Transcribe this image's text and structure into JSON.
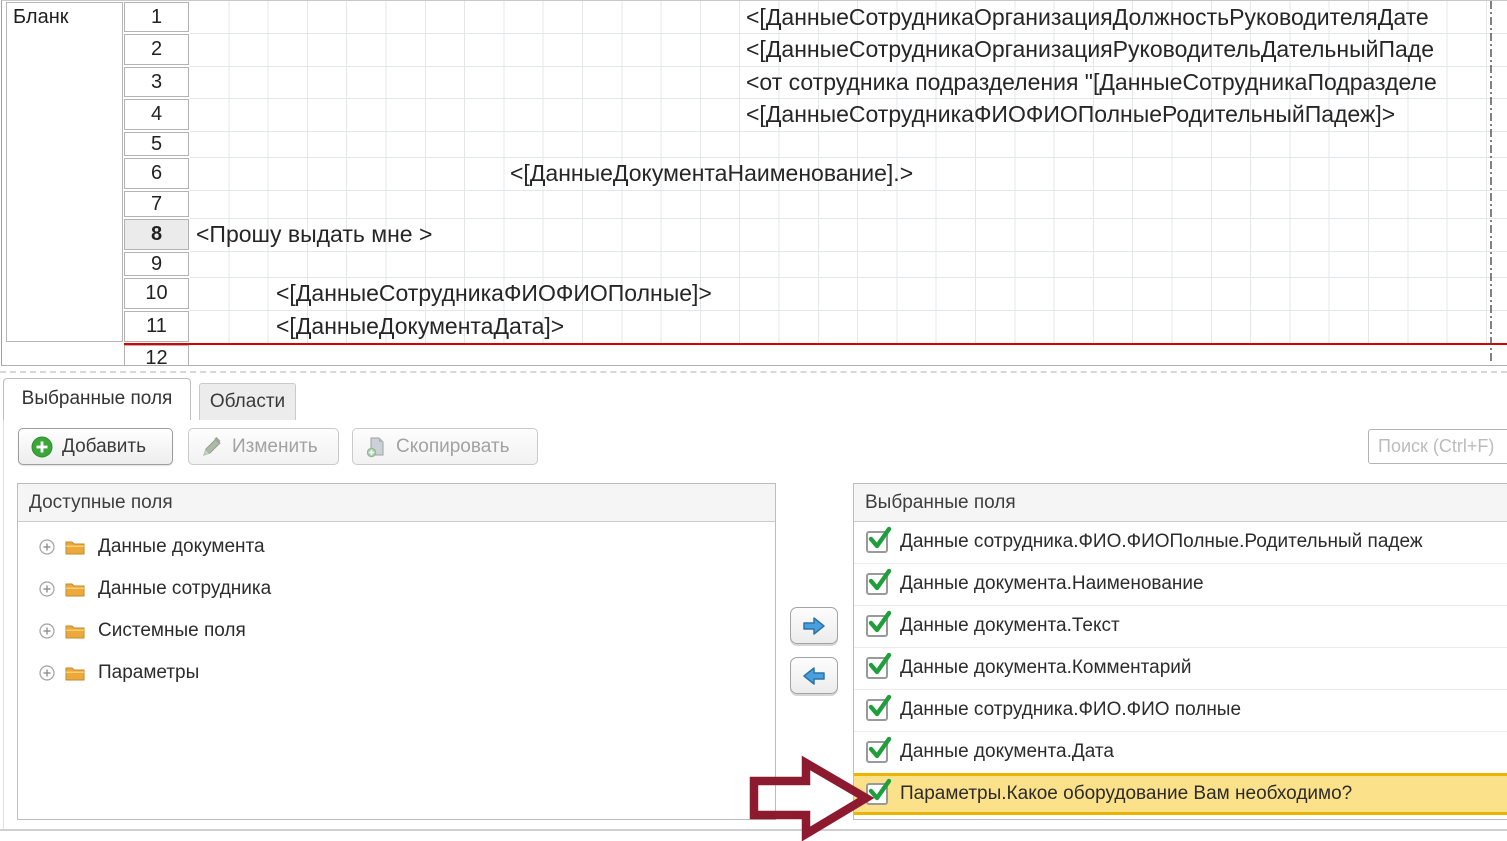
{
  "editor": {
    "section_label": "Бланк",
    "rows": [
      {
        "num": "1",
        "text": "<[ДанныеСотрудникаОрганизацияДолжностьРуководителяДате"
      },
      {
        "num": "2",
        "text": "<[ДанныеСотрудникаОрганизацияРуководительДательныйПаде"
      },
      {
        "num": "3",
        "text": "<от сотрудника подразделения \"[ДанныеСотрудникаПодразделе"
      },
      {
        "num": "4",
        "text": "<[ДанныеСотрудникаФИОФИОПолныеРодительныйПадеж]>"
      },
      {
        "num": "5",
        "text": ""
      },
      {
        "num": "6",
        "text": "<[ДанныеДокументаНаименование].>"
      },
      {
        "num": "7",
        "text": ""
      },
      {
        "num": "8",
        "text": "<Прошу выдать мне >",
        "selected": true
      },
      {
        "num": "9",
        "text": ""
      },
      {
        "num": "10",
        "text": "<[ДанныеСотрудникаФИОФИОПолные]>"
      },
      {
        "num": "11",
        "text": "<[ДанныеДокументаДата]>"
      },
      {
        "num": "12",
        "text": ""
      }
    ]
  },
  "tabs": {
    "selected_fields": "Выбранные поля",
    "areas": "Области"
  },
  "toolbar": {
    "add_label": "Добавить",
    "edit_label": "Изменить",
    "copy_label": "Скопировать",
    "search_placeholder": "Поиск (Ctrl+F)"
  },
  "available_panel": {
    "title": "Доступные поля",
    "items": [
      {
        "label": "Данные документа"
      },
      {
        "label": "Данные сотрудника"
      },
      {
        "label": "Системные поля"
      },
      {
        "label": "Параметры"
      }
    ]
  },
  "selected_panel": {
    "title": "Выбранные поля",
    "items": [
      {
        "label": "Данные сотрудника.ФИО.ФИОПолные.Родительный падеж",
        "checked": true
      },
      {
        "label": "Данные документа.Наименование",
        "checked": true
      },
      {
        "label": "Данные документа.Текст",
        "checked": true
      },
      {
        "label": "Данные документа.Комментарий",
        "checked": true
      },
      {
        "label": "Данные сотрудника.ФИО.ФИО полные",
        "checked": true
      },
      {
        "label": "Данные документа.Дата",
        "checked": true
      },
      {
        "label": "Параметры.Какое оборудование Вам необходимо?",
        "checked": true,
        "highlighted": true
      }
    ]
  },
  "icons": {
    "add": "green-plus-circle-icon",
    "edit": "pencil-icon",
    "copy": "copy-document-icon",
    "expand": "expand-plus-icon",
    "folder": "folder-icon",
    "move_right": "blue-arrow-right-icon",
    "move_left": "blue-arrow-left-icon",
    "check": "green-check-icon",
    "annotation": "red-arrow-annotation"
  },
  "colors": {
    "grid_line": "#e4e7e9",
    "red_break_line": "#da0000",
    "highlight_bg": "#fbe28a",
    "highlight_border": "#e9b502",
    "check_green": "#1f9e3c",
    "arrow_blue": "#4aa0de",
    "annotation_maroon": "#8d1a2e",
    "folder_amber": "#eda93c"
  }
}
